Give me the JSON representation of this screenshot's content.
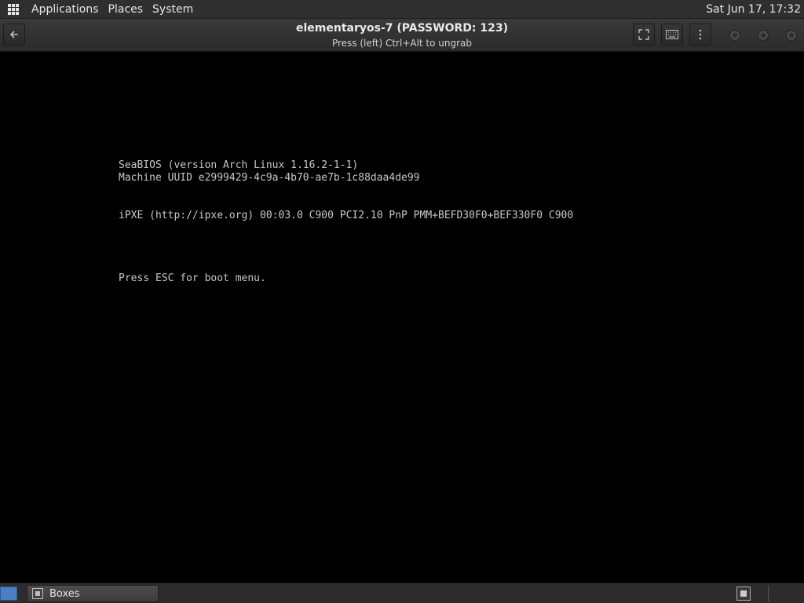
{
  "top_panel": {
    "menus": [
      "Applications",
      "Places",
      "System"
    ],
    "clock": "Sat Jun 17, 17:32"
  },
  "header": {
    "title": "elementaryos-7 (PASSWORD: 123)",
    "subtitle": "Press (left) Ctrl+Alt to ungrab",
    "back_icon": "back-arrow-icon",
    "buttons": [
      "fullscreen-icon",
      "keyboard-icon",
      "menu-dots-icon"
    ]
  },
  "console": {
    "lines": [
      "SeaBIOS (version Arch Linux 1.16.2-1-1)",
      "Machine UUID e2999429-4c9a-4b70-ae7b-1c88daa4de99",
      "iPXE (http://ipxe.org) 00:03.0 C900 PCI2.10 PnP PMM+BEFD30F0+BEF330F0 C900",
      "Press ESC for boot menu."
    ]
  },
  "taskbar": {
    "task_label": "Boxes"
  }
}
